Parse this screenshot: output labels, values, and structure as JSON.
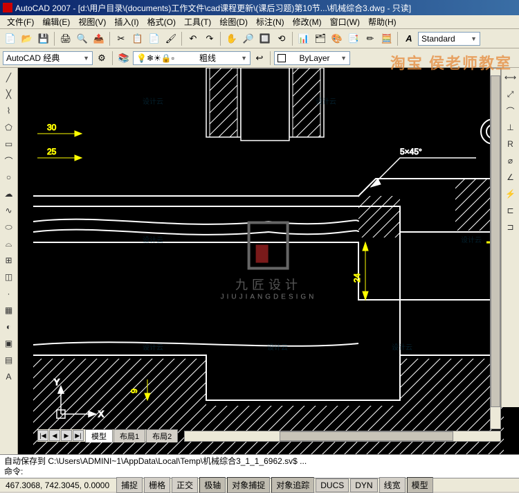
{
  "title": "AutoCAD 2007 - [d:\\用户目录\\(documents)工作文件\\cad课程更新\\(课后习题)第10节...\\机械综合3.dwg - 只读]",
  "menu": [
    "文件(F)",
    "编辑(E)",
    "视图(V)",
    "插入(I)",
    "格式(O)",
    "工具(T)",
    "绘图(D)",
    "标注(N)",
    "修改(M)",
    "窗口(W)",
    "帮助(H)"
  ],
  "workspace": "AutoCAD 经典",
  "layer": "粗线",
  "bylayer": "ByLayer",
  "style": "Standard",
  "tabs": {
    "nav": [
      "|◀",
      "◀",
      "▶",
      "▶|"
    ],
    "items": [
      "模型",
      "布局1",
      "布局2"
    ]
  },
  "cmd": {
    "line1": "自动保存到 C:\\Users\\ADMINI~1\\AppData\\Local\\Temp\\机械综合3_1_1_6962.sv$ ...",
    "line2": "命令:"
  },
  "status": {
    "coords": "467.3068, 742.3045, 0.0000",
    "buttons": [
      "捕捉",
      "栅格",
      "正交",
      "极轴",
      "对象捕捉",
      "对象追踪",
      "DUCS",
      "DYN",
      "线宽",
      "模型"
    ]
  },
  "dims": {
    "d30": "30",
    "d25": "25",
    "d24": "24",
    "d9": "9",
    "chamfer": "5×45°"
  },
  "logo": {
    "brand": "九匠设计",
    "en": "JIUJIANGDESIGN"
  },
  "watermark_corner": "淘宝 侯老师教室",
  "wm": "设计云"
}
